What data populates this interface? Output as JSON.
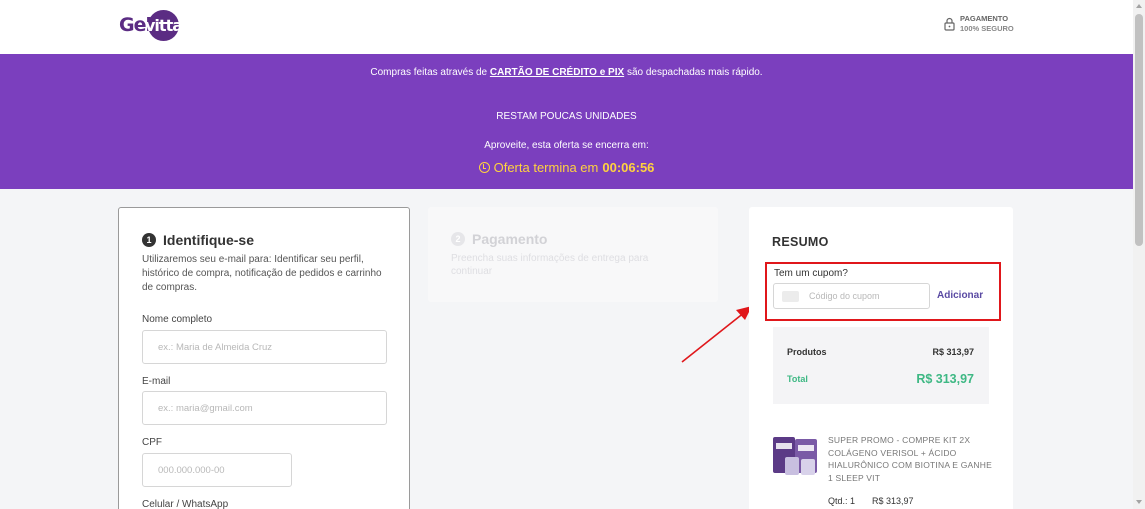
{
  "header": {
    "logo_left": "Gel",
    "logo_right": "vitta",
    "secure_line1": "PAGAMENTO",
    "secure_line2": "100% SEGURO",
    "secure_icon": "lock-icon"
  },
  "banner": {
    "prefix": "Compras feitas através de ",
    "highlight": "CARTÃO DE CRÉDITO e PIX",
    "suffix": " são despachadas mais rápido.",
    "stock": "RESTAM POUCAS UNIDADES",
    "offer": "Aproveite, esta oferta se encerra em:",
    "timer_label": "Oferta termina em",
    "timer_value": "00:06:56",
    "timer_icon": "clock-icon",
    "color": "#7b3fbe",
    "timer_color": "#ffd23f"
  },
  "step1": {
    "number": "1",
    "title": "Identifique-se",
    "description": "Utilizaremos seu e-mail para: Identificar seu perfil, histórico de compra, notificação de pedidos e carrinho de compras.",
    "fields": {
      "name": {
        "label": "Nome completo",
        "placeholder": "ex.: Maria de Almeida Cruz",
        "value": ""
      },
      "email": {
        "label": "E-mail",
        "placeholder": "ex.: maria@gmail.com",
        "value": ""
      },
      "cpf": {
        "label": "CPF",
        "placeholder": "000.000.000-00",
        "value": ""
      },
      "phone": {
        "label": "Celular / WhatsApp"
      }
    }
  },
  "step2": {
    "number": "2",
    "title": "Pagamento",
    "description": "Preencha suas informações de entrega para continuar"
  },
  "summary": {
    "title": "RESUMO",
    "coupon_label": "Tem um cupom?",
    "coupon_placeholder": "Código do cupom",
    "coupon_button": "Adicionar",
    "coupon_icon": "tag-icon",
    "highlight_color": "#e0171b",
    "products_label": "Produtos",
    "products_value": "R$ 313,97",
    "total_label": "Total",
    "total_value": "R$ 313,97",
    "total_color": "#3eb884",
    "item": {
      "name": "SUPER PROMO - COMPRE KIT 2X COLÁGENO VERISOL + ÁCIDO HIALURÔNICO COM BIOTINA E GANHE 1 SLEEP VIT",
      "qty": "Qtd.: 1",
      "price": "R$ 313,97"
    }
  }
}
